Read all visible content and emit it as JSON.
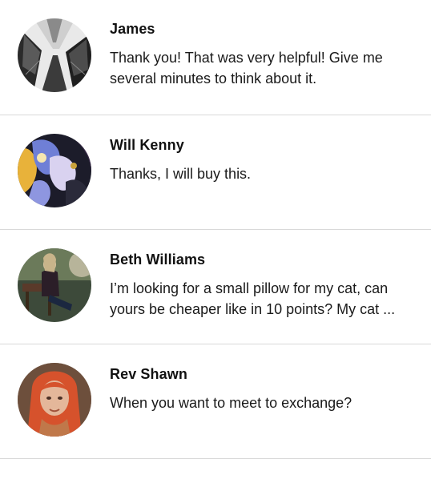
{
  "conversations": [
    {
      "name": "James",
      "message": "Thank you! That was very helpful! Give me several minutes to think about it.",
      "avatar": "skyscrapers-photo"
    },
    {
      "name": "Will Kenny",
      "message": "Thanks, I will buy this.",
      "avatar": "abstract-paint-photo"
    },
    {
      "name": "Beth Williams",
      "message": "I’m looking for a small pillow for my cat, can yours be cheaper like in 10 points? My cat ...",
      "avatar": "woman-on-bench-photo"
    },
    {
      "name": "Rev Shawn",
      "message": "When you want to meet to exchange?",
      "avatar": "woman-red-hair-photo"
    }
  ],
  "colors": {
    "divider": "#d9d9d9",
    "name_text": "#111111",
    "message_text": "#1a1a1a"
  }
}
